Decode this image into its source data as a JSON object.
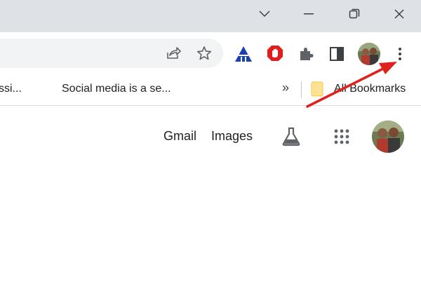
{
  "bookmarks": {
    "item1_label": "ssi...",
    "item2_label": "Social media is a se...",
    "overflow_glyph": "»",
    "all_bookmarks_label": "All Bookmarks"
  },
  "google": {
    "gmail_label": "Gmail",
    "images_label": "Images"
  },
  "colors": {
    "titlebar": "#dee1e6",
    "omnibox": "#f1f3f4",
    "annotation_arrow": "#e0201b",
    "adblock_red": "#e01e1e",
    "triangle_ext_blue": "#1a3fb0"
  }
}
